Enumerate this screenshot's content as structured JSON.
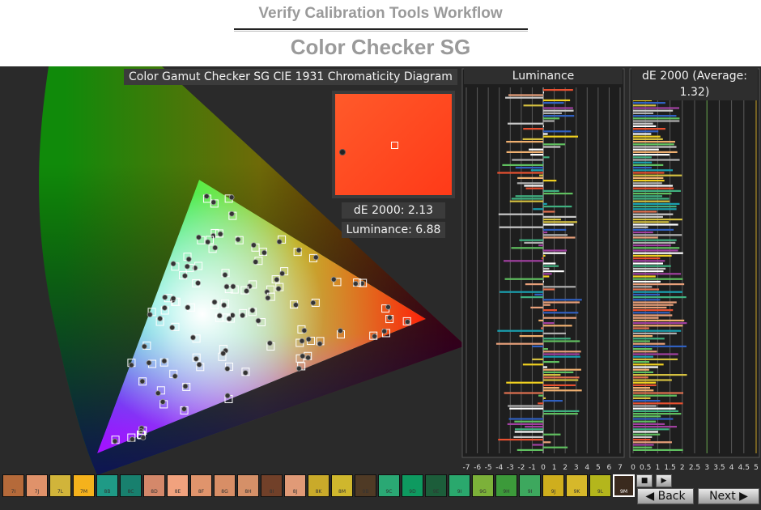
{
  "header": {
    "workflow_title": "Verify Calibration Tools Workflow",
    "page_title": "Color Checker SG"
  },
  "chromaticity": {
    "title": "Color Gamut Checker SG CIE 1931 Chromaticity Diagram",
    "selected_swatch_color": "#ff4a1e",
    "de_label": "dE 2000: 2.13",
    "luminance_label": "Luminance: 6.88"
  },
  "luminance_chart": {
    "title": "Luminance",
    "ticks": [
      "-7",
      "-6",
      "-5",
      "-4",
      "-3",
      "-2",
      "-1",
      "0",
      "1",
      "2",
      "3",
      "4",
      "5",
      "6",
      "7"
    ]
  },
  "de_chart": {
    "title": "dE 2000 (Average: 1.32)",
    "ticks": [
      "0",
      "0.5",
      "1",
      "1.5",
      "2",
      "2.5",
      "3",
      "3.5",
      "4",
      "4.5",
      "5"
    ]
  },
  "swatches": [
    {
      "label": "7I",
      "color": "#b56a3a"
    },
    {
      "label": "7J",
      "color": "#e0926a"
    },
    {
      "label": "7L",
      "color": "#d1b43a"
    },
    {
      "label": "7M",
      "color": "#f5b21c"
    },
    {
      "label": "8B",
      "color": "#1f9a86"
    },
    {
      "label": "8C",
      "color": "#18806e"
    },
    {
      "label": "8D",
      "color": "#d4886a"
    },
    {
      "label": "8E",
      "color": "#f1a27e"
    },
    {
      "label": "8F",
      "color": "#e0946c"
    },
    {
      "label": "8G",
      "color": "#d88e66"
    },
    {
      "label": "8H",
      "color": "#d59068"
    },
    {
      "label": "8I",
      "color": "#714029"
    },
    {
      "label": "8J",
      "color": "#e09a77"
    },
    {
      "label": "8K",
      "color": "#c9aa2a"
    },
    {
      "label": "8M",
      "color": "#cfb72d"
    },
    {
      "label": "9B",
      "color": "#4f3a25"
    },
    {
      "label": "9C",
      "color": "#2aa874"
    },
    {
      "label": "9D",
      "color": "#0e9a60"
    },
    {
      "label": "9E",
      "color": "#1c5d3a"
    },
    {
      "label": "9I",
      "color": "#2aa86d"
    },
    {
      "label": "9G",
      "color": "#7cb139"
    },
    {
      "label": "9H",
      "color": "#3c9a3a"
    },
    {
      "label": "9I",
      "color": "#3da85e"
    },
    {
      "label": "9J",
      "color": "#cfae1d"
    },
    {
      "label": "9K",
      "color": "#d6b82a"
    },
    {
      "label": "9L",
      "color": "#b4b61c"
    },
    {
      "label": "9M",
      "color": "#3a2a1e"
    }
  ],
  "nav": {
    "back_label": "Back",
    "next_label": "Next"
  }
}
